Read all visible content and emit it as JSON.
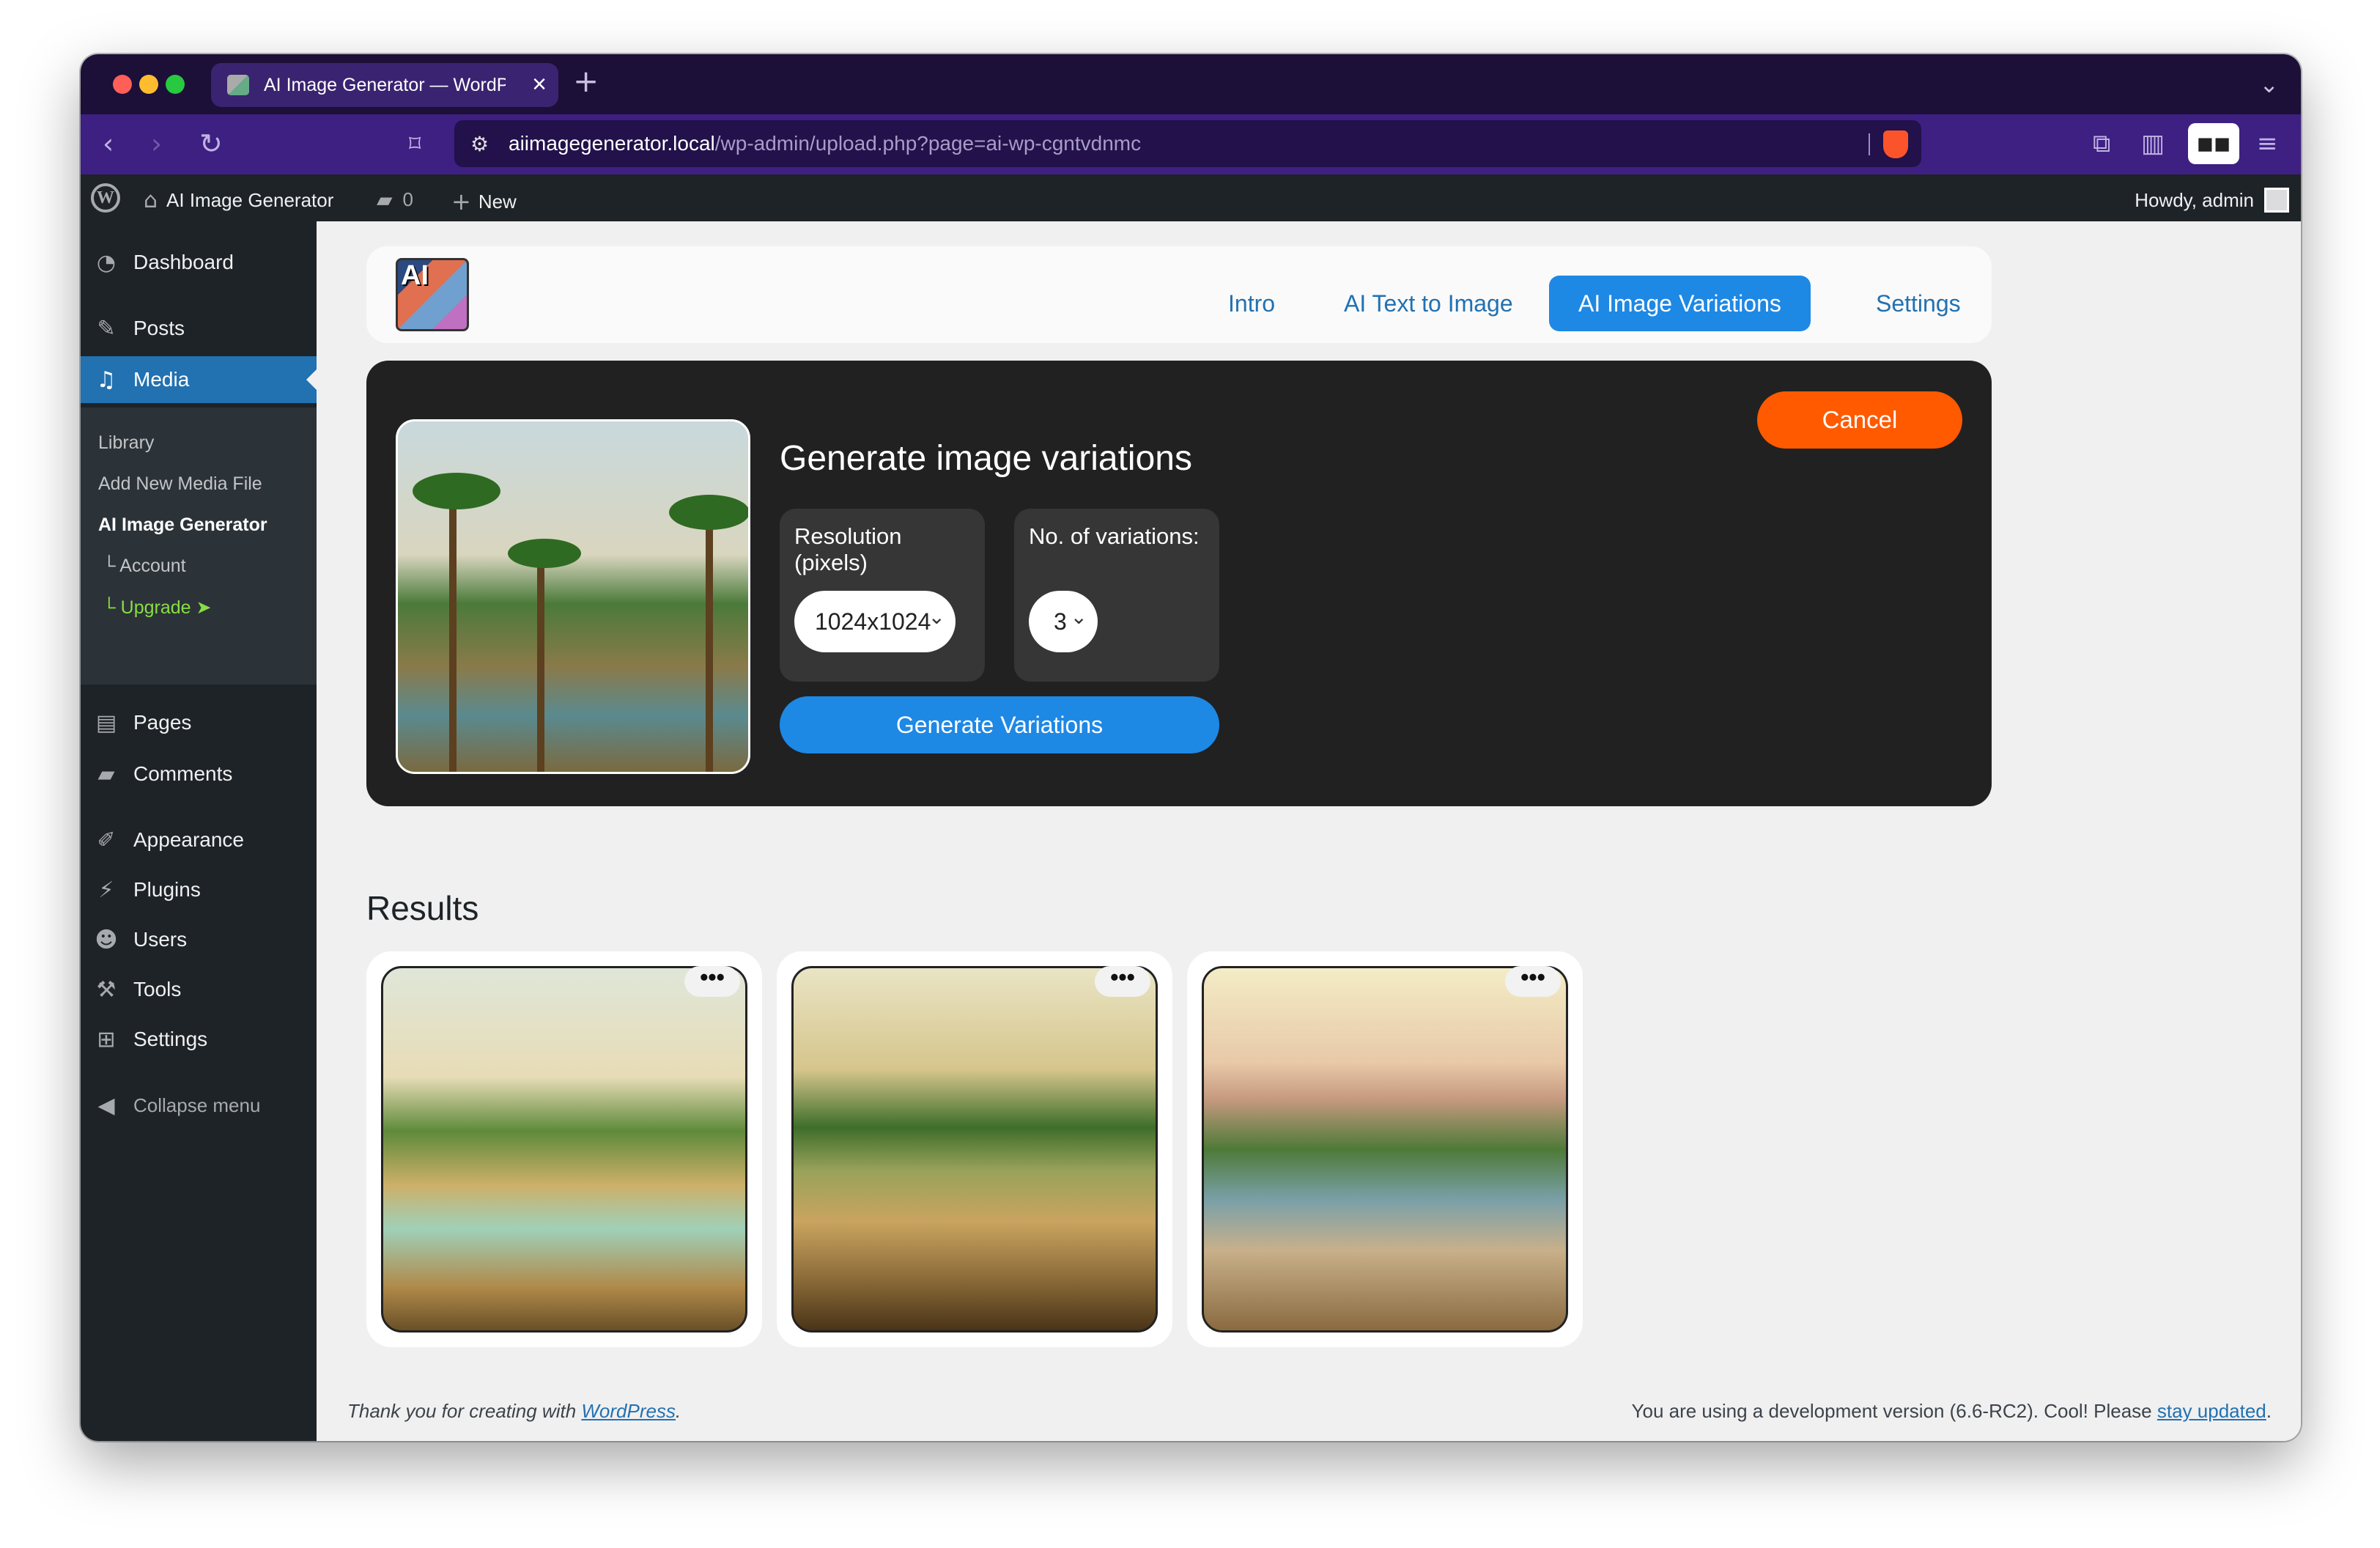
{
  "browser": {
    "tab_title": "AI Image Generator — WordPress",
    "url_host": "aiimagegenerator.local",
    "url_path": "/wp-admin/upload.php?page=ai-wp-cgntvdnmc"
  },
  "adminbar": {
    "site_name": "AI Image Generator",
    "comments_count": "0",
    "new_label": "New",
    "howdy": "Howdy, admin"
  },
  "sidebar": {
    "items": [
      {
        "label": "Dashboard",
        "icon": "dashboard-icon"
      },
      {
        "label": "Posts",
        "icon": "pin-icon"
      },
      {
        "label": "Media",
        "icon": "media-icon"
      },
      {
        "label": "Pages",
        "icon": "pages-icon"
      },
      {
        "label": "Comments",
        "icon": "comment-icon"
      },
      {
        "label": "Appearance",
        "icon": "brush-icon"
      },
      {
        "label": "Plugins",
        "icon": "plug-icon"
      },
      {
        "label": "Users",
        "icon": "user-icon"
      },
      {
        "label": "Tools",
        "icon": "wrench-icon"
      },
      {
        "label": "Settings",
        "icon": "settings-icon"
      },
      {
        "label": "Collapse menu",
        "icon": "collapse-icon"
      }
    ],
    "submenu": [
      "Library",
      "Add New Media File",
      "AI Image Generator",
      "└ Account",
      "└ Upgrade ➤"
    ]
  },
  "plugin_nav": {
    "logo_text": "AI",
    "tabs": [
      "Intro",
      "AI Text to Image",
      "AI Image Variations",
      "Settings"
    ],
    "active_tab": "AI Image Variations"
  },
  "generator": {
    "title": "Generate image variations",
    "resolution_label": "Resolution (pixels)",
    "resolution_value": "1024x1024",
    "variations_label": "No. of variations:",
    "variations_value": "3",
    "generate_label": "Generate Variations",
    "cancel_label": "Cancel"
  },
  "results": {
    "heading": "Results",
    "more_label": "•••"
  },
  "footer": {
    "thanks_prefix": "Thank you for creating with",
    "wp_link": "WordPress",
    "thanks_suffix": ".",
    "dev_text": "You are using a development version (6.6-RC2). Cool! Please",
    "update_link": "stay updated",
    "dev_suffix": "."
  },
  "colors": {
    "accent": "#1e88e5",
    "cancel": "#ff5a00",
    "wp_blue": "#2271b1",
    "upgrade": "#88dd44"
  }
}
